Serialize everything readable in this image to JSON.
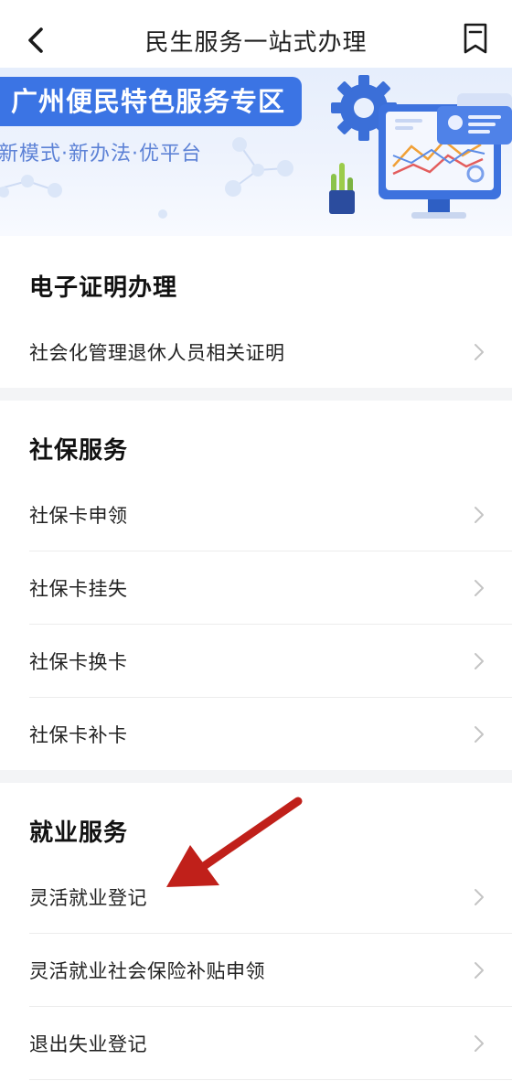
{
  "header": {
    "title": "民生服务一站式办理",
    "back_icon": "chevron-left-icon",
    "bookmark_icon": "bookmark-icon"
  },
  "banner": {
    "tag": "广州便民特色服务专区",
    "subtitle": "新模式·新办法·优平台",
    "illustration": "monitor-chart-gear-illustration",
    "accent_color": "#3b74e4"
  },
  "sections": [
    {
      "title": "电子证明办理",
      "items": [
        {
          "label": "社会化管理退休人员相关证明"
        }
      ]
    },
    {
      "title": "社保服务",
      "items": [
        {
          "label": "社保卡申领"
        },
        {
          "label": "社保卡挂失"
        },
        {
          "label": "社保卡换卡"
        },
        {
          "label": "社保卡补卡"
        }
      ]
    },
    {
      "title": "就业服务",
      "items": [
        {
          "label": "灵活就业登记"
        },
        {
          "label": "灵活就业社会保险补贴申领"
        },
        {
          "label": "退出失业登记"
        }
      ]
    }
  ],
  "annotation": {
    "arrow_color": "#c0201a",
    "points_to": "灵活就业登记"
  }
}
